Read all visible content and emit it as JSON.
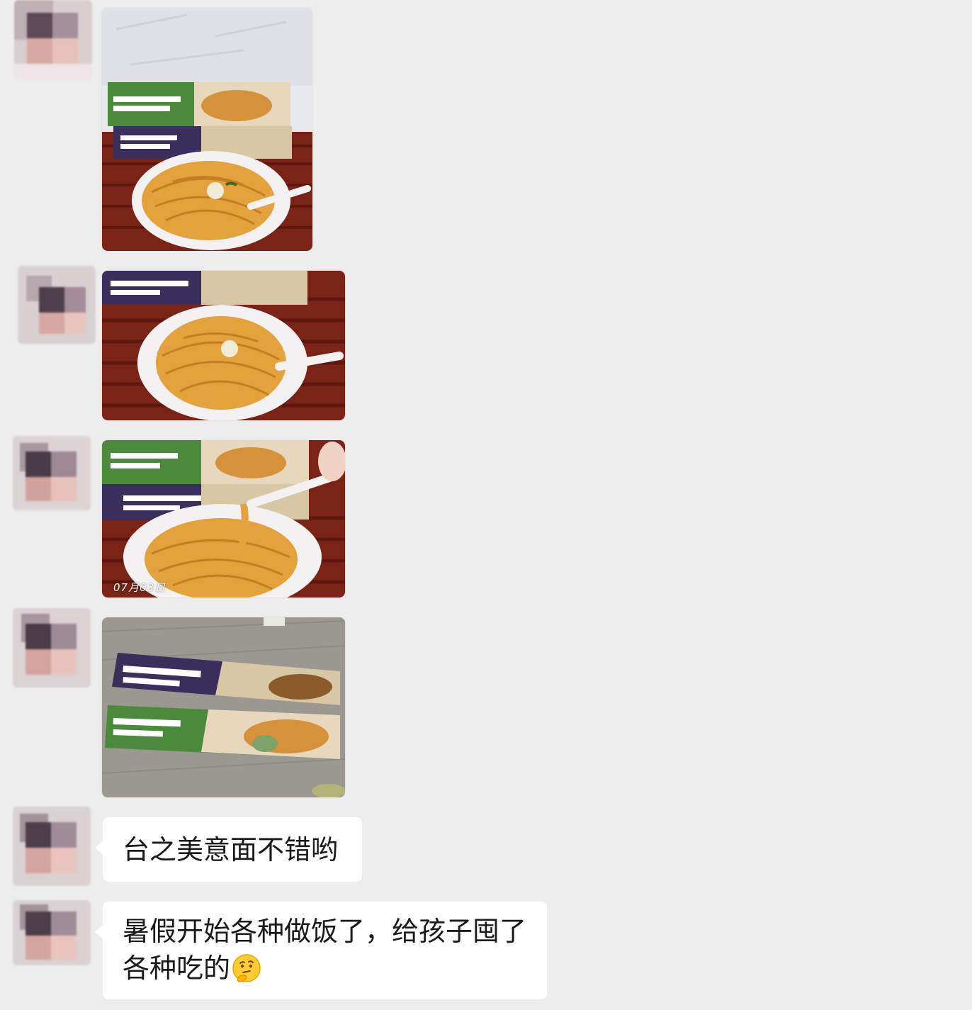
{
  "chat": {
    "messages": [
      {
        "type": "image",
        "alt": "pasta bowl with two boxes"
      },
      {
        "type": "image",
        "alt": "pasta bowl close-up"
      },
      {
        "type": "image",
        "alt": "pasta with spoon",
        "overlay_text": "07月03日"
      },
      {
        "type": "image",
        "alt": "two pasta boxes on counter"
      },
      {
        "type": "text",
        "text": "台之美意面不错哟"
      },
      {
        "type": "text",
        "text": "暑假开始各种做饭了，给孩子囤了各种吃的",
        "line1": "暑假开始各种做饭了，给孩子囤了",
        "line2": "各种吃的",
        "emoji": "thinking-face"
      }
    ]
  },
  "colors": {
    "background": "#ededed",
    "bubble": "#ffffff",
    "text": "#1a1a1a",
    "box_green": "#4a8a3a",
    "box_purple": "#3a2f5c",
    "pasta": "#e3a23c",
    "table_red": "#7a2418"
  }
}
